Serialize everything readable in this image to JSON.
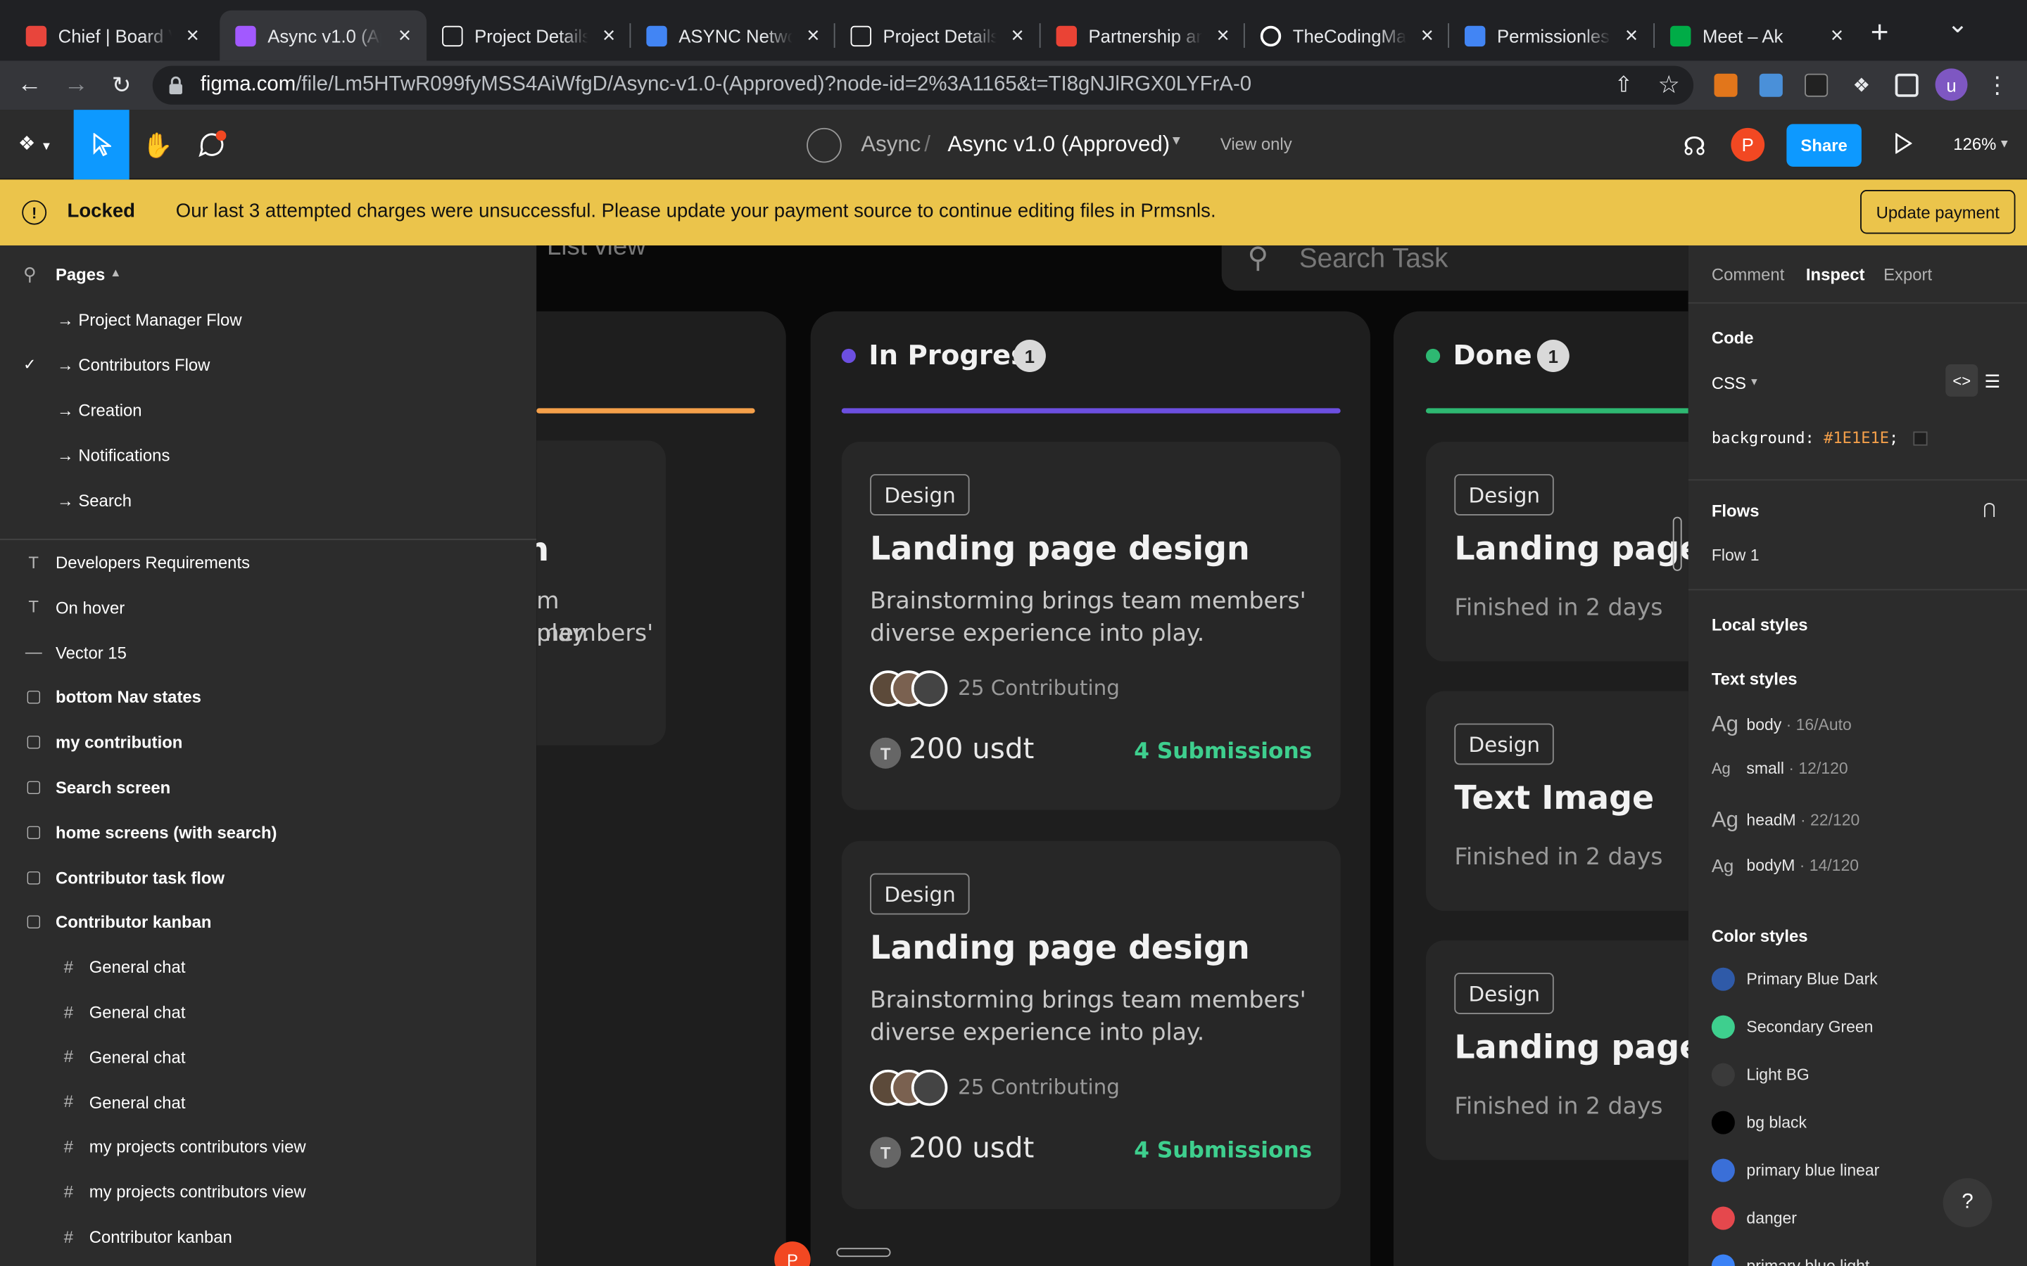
{
  "browser": {
    "tabs": [
      {
        "title": "Chief | Board V",
        "icon": "chief-icon",
        "color": "#e8453c"
      },
      {
        "title": "Async v1.0 (Ap",
        "icon": "figma-icon",
        "color": "#a259ff"
      },
      {
        "title": "Project Details",
        "icon": "async-icon",
        "color": "#ffffff"
      },
      {
        "title": "ASYNC Netwo",
        "icon": "google-docs-icon",
        "color": "#4285f4"
      },
      {
        "title": "Project Details",
        "icon": "async-icon",
        "color": "#ffffff"
      },
      {
        "title": "Partnership an",
        "icon": "gmail-icon",
        "color": "#ea4335"
      },
      {
        "title": "TheCodingMa",
        "icon": "github-icon",
        "color": "#ffffff"
      },
      {
        "title": "Permissionles",
        "icon": "calendar-icon",
        "color": "#4285f4"
      },
      {
        "title": "Meet – Ak",
        "icon": "meet-icon",
        "color": "#00ac47"
      }
    ],
    "url_domain": "figma.com",
    "url_path": "/file/Lm5HTwR099fyMSS4AiWfgD/Async-v1.0-(Approved)?node-id=2%3A1165&t=TI8gNJlRGX0LYFrA-0",
    "profile_initial": "u"
  },
  "figma": {
    "project": "Async",
    "separator": "/",
    "file_name": "Async v1.0 (Approved)",
    "view_only": "View only",
    "share": "Share",
    "zoom": "126%",
    "user_initial": "P",
    "accent": "#0d99ff"
  },
  "banner": {
    "title": "Locked",
    "message": "Our last 3 attempted charges were unsuccessful. Please update your payment source to continue editing files in Prmsnls.",
    "button": "Update payment"
  },
  "left_panel": {
    "pages_label": "Pages",
    "pages": [
      {
        "label": "→ Project Manager Flow",
        "selected": false
      },
      {
        "label": "→ Contributors Flow",
        "selected": true
      },
      {
        "label": "→ Creation",
        "selected": false
      },
      {
        "label": "→ Notifications",
        "selected": false
      },
      {
        "label": "→ Search",
        "selected": false
      }
    ],
    "layers": [
      {
        "label": "Developers Requirements",
        "icon": "text-icon",
        "bold": false,
        "indent": 0
      },
      {
        "label": "On hover",
        "icon": "text-icon",
        "bold": false,
        "indent": 0
      },
      {
        "label": "Vector 15",
        "icon": "line-icon",
        "bold": false,
        "indent": 0
      },
      {
        "label": "bottom Nav states",
        "icon": "section-icon",
        "bold": true,
        "indent": 0
      },
      {
        "label": "my contribution",
        "icon": "section-icon",
        "bold": true,
        "indent": 0
      },
      {
        "label": "Search screen",
        "icon": "section-icon",
        "bold": true,
        "indent": 0
      },
      {
        "label": "home screens (with search)",
        "icon": "section-icon",
        "bold": true,
        "indent": 0
      },
      {
        "label": "Contributor task flow",
        "icon": "section-icon",
        "bold": true,
        "indent": 0
      },
      {
        "label": "Contributor kanban",
        "icon": "section-icon",
        "bold": true,
        "indent": 0
      },
      {
        "label": "General chat",
        "icon": "frame-icon",
        "bold": false,
        "indent": 1
      },
      {
        "label": "General chat",
        "icon": "frame-icon",
        "bold": false,
        "indent": 1
      },
      {
        "label": "General chat",
        "icon": "frame-icon",
        "bold": false,
        "indent": 1
      },
      {
        "label": "General chat",
        "icon": "frame-icon",
        "bold": false,
        "indent": 1
      },
      {
        "label": "my projects contributors view",
        "icon": "frame-icon",
        "bold": false,
        "indent": 1
      },
      {
        "label": "my projects contributors view",
        "icon": "frame-icon",
        "bold": false,
        "indent": 1
      },
      {
        "label": "Contributor kanban",
        "icon": "frame-icon",
        "bold": false,
        "indent": 1
      }
    ]
  },
  "canvas": {
    "list_view": "List view",
    "search_placeholder": "Search Task",
    "col0_fragments": {
      "title": "gn",
      "desc1": "m members'",
      "desc2": "play."
    },
    "in_progress": {
      "label": "In Progress",
      "count": "1",
      "color": "#6c4fe0"
    },
    "done": {
      "label": "Done",
      "count": "1",
      "color": "#2eb872"
    },
    "todo_color": "#f5a04a",
    "card_tag": "Design",
    "cards": [
      {
        "tag": "Design",
        "title": "Landing page design",
        "desc1": "Brainstorming brings team members'",
        "desc2": "diverse experience into play.",
        "contributing": "25 Contributing",
        "amount": "200 usdt",
        "submissions": "4 Submissions"
      },
      {
        "tag": "Design",
        "title": "Landing page design",
        "desc1": "Brainstorming brings team members'",
        "desc2": "diverse experience into play.",
        "contributing": "25 Contributing",
        "amount": "200 usdt",
        "submissions": "4 Submissions"
      }
    ],
    "done_cards": [
      {
        "tag": "Design",
        "title": "Landing page des",
        "finished": "Finished in 2 days"
      },
      {
        "tag": "Design",
        "title": "Text Image",
        "finished": "Finished in 2 days"
      },
      {
        "tag": "Design",
        "title": "Landing page des",
        "finished": "Finished in 2 days"
      }
    ],
    "coin_symbol": "T",
    "cursor_initial": "P"
  },
  "right_panel": {
    "tabs": [
      "Comment",
      "Inspect",
      "Export"
    ],
    "code_label": "Code",
    "code_lang": "CSS",
    "css_prop": "background:",
    "css_value": "#1E1E1E",
    "css_semicolon": ";",
    "flows_label": "Flows",
    "flow_item": "Flow 1",
    "local_styles": "Local styles",
    "text_styles_label": "Text styles",
    "text_styles": [
      {
        "name": "body",
        "meta": " · 16/Auto"
      },
      {
        "name": "small",
        "meta": " · 12/120"
      },
      {
        "name": "headM",
        "meta": " · 22/120"
      },
      {
        "name": "bodyM",
        "meta": " · 14/120"
      }
    ],
    "color_styles_label": "Color styles",
    "color_styles": [
      {
        "name": "Primary Blue Dark",
        "color": "#2f5aa8"
      },
      {
        "name": "Secondary Green",
        "color": "#3ecf8e"
      },
      {
        "name": "Light BG",
        "color": "#3a3a3a"
      },
      {
        "name": "bg black",
        "color": "#000000"
      },
      {
        "name": "primary blue linear",
        "color": "#3a6fd8"
      },
      {
        "name": "danger",
        "color": "#e5484d"
      },
      {
        "name": "primary blue light",
        "color": "#3b82f6"
      }
    ],
    "help": "?"
  }
}
